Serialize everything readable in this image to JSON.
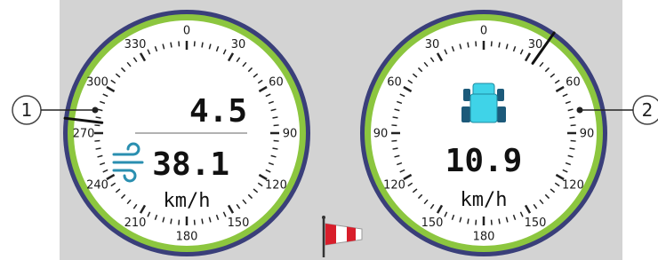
{
  "left_gauge": {
    "scale_labels": [
      {
        "angle": 0,
        "text": "0"
      },
      {
        "angle": 30,
        "text": "30"
      },
      {
        "angle": 60,
        "text": "60"
      },
      {
        "angle": 90,
        "text": "90"
      },
      {
        "angle": 120,
        "text": "120"
      },
      {
        "angle": 150,
        "text": "150"
      },
      {
        "angle": 180,
        "text": "180"
      },
      {
        "angle": 210,
        "text": "210"
      },
      {
        "angle": 240,
        "text": "240"
      },
      {
        "angle": 270,
        "text": "270"
      },
      {
        "angle": 300,
        "text": "300"
      },
      {
        "angle": 330,
        "text": "330"
      }
    ],
    "direction_value": "4.5",
    "speed_value": "38.1",
    "unit": "km/h",
    "needle_direction_deg": 277,
    "icon": "wind-icon"
  },
  "right_gauge": {
    "scale_labels": [
      {
        "angle": 0,
        "text": "0"
      },
      {
        "angle": 30,
        "text": "30"
      },
      {
        "angle": 60,
        "text": "60"
      },
      {
        "angle": 90,
        "text": "90"
      },
      {
        "angle": 120,
        "text": "120"
      },
      {
        "angle": 150,
        "text": "150"
      },
      {
        "angle": 180,
        "text": "180"
      },
      {
        "angle": 210,
        "text": "150"
      },
      {
        "angle": 240,
        "text": "120"
      },
      {
        "angle": 270,
        "text": "90"
      },
      {
        "angle": 300,
        "text": "60"
      },
      {
        "angle": 330,
        "text": "30"
      }
    ],
    "speed_value": "10.9",
    "unit": "km/h",
    "needle_direction_deg": 35,
    "icon": "tractor-icon"
  },
  "windsock_icon": "windsock-icon",
  "callouts": {
    "left": "1",
    "right": "2"
  },
  "colors": {
    "panel": "#d3d3d3",
    "gauge_outer_ring": "#3a3f7a",
    "gauge_green_ring": "#8cc63f",
    "wind_icon": "#2a8fb0",
    "tractor_icon": "#3fd3e8",
    "windsock_red": "#d81e2b"
  }
}
